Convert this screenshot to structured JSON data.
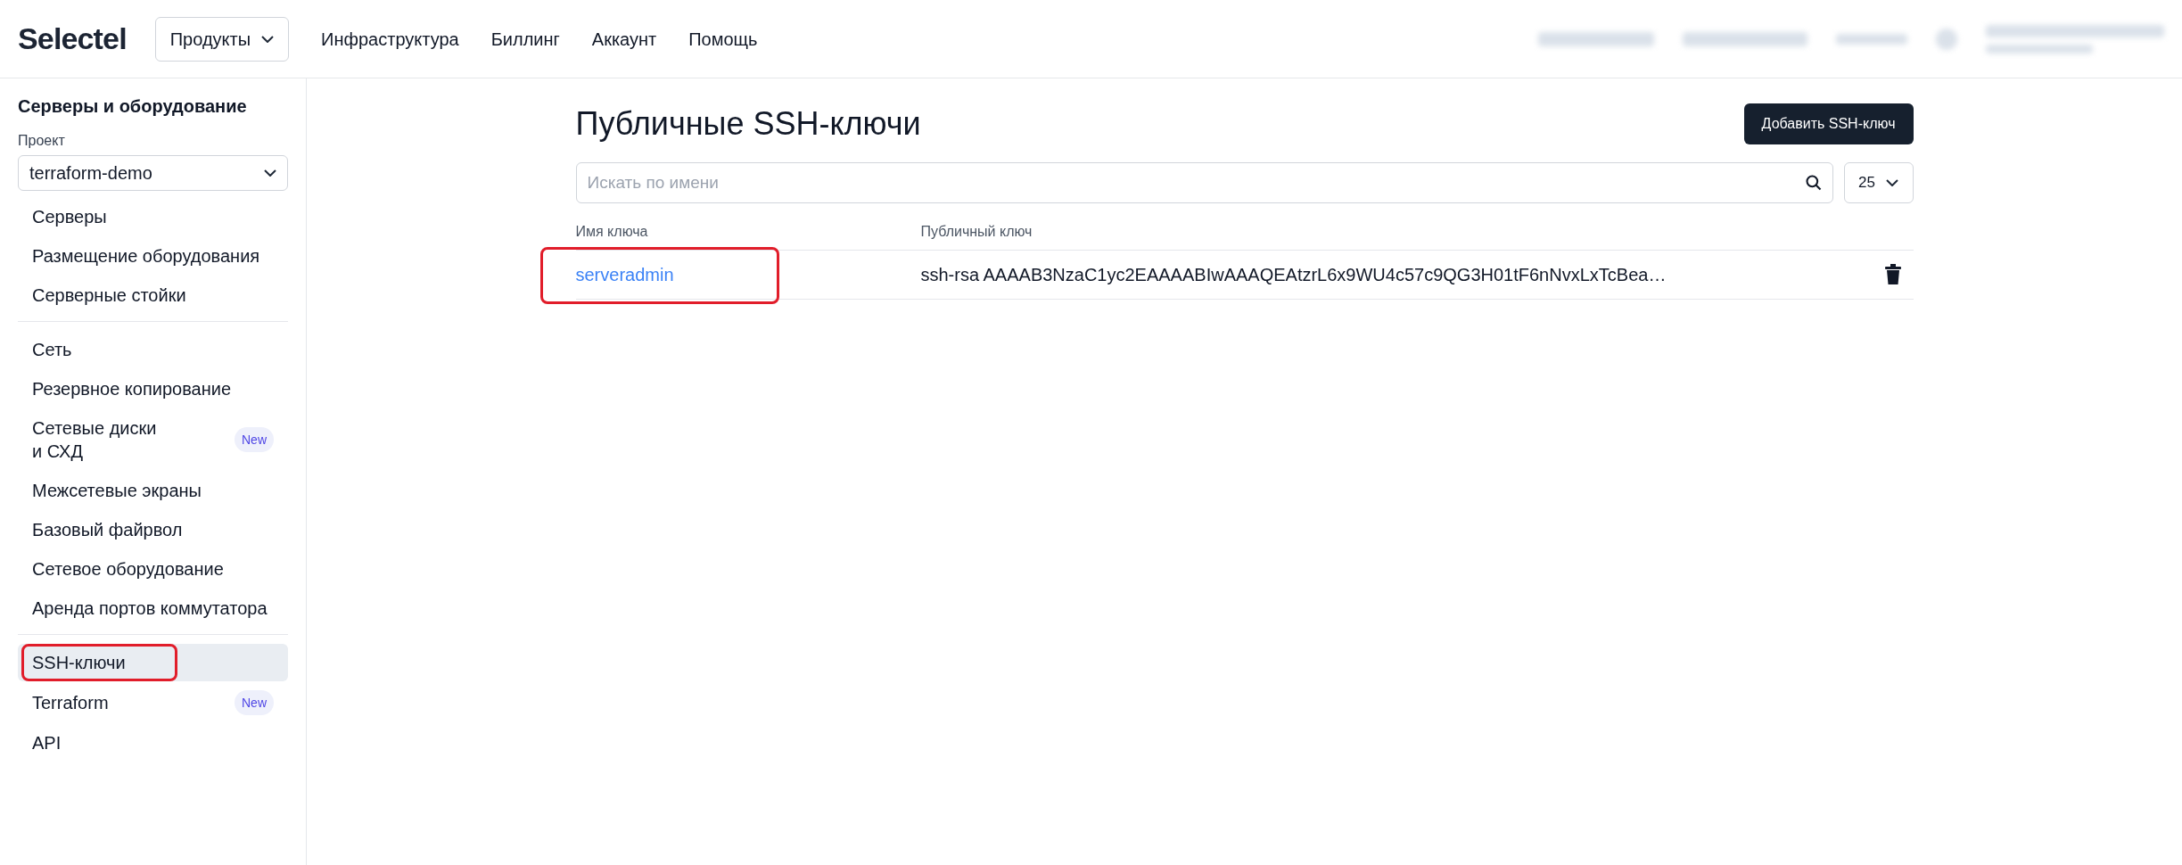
{
  "header": {
    "logo": "Selectel",
    "products": "Продукты",
    "nav": [
      "Инфраструктура",
      "Биллинг",
      "Аккаунт",
      "Помощь"
    ]
  },
  "sidebar": {
    "title": "Серверы и оборудование",
    "project_label": "Проект",
    "project": "terraform-demo",
    "groups": [
      [
        {
          "label": "Серверы",
          "selected": false
        },
        {
          "label": "Размещение оборудования",
          "selected": false
        },
        {
          "label": "Серверные стойки",
          "selected": false
        }
      ],
      [
        {
          "label": "Сеть",
          "selected": false
        },
        {
          "label": "Резервное копирование",
          "selected": false
        },
        {
          "label": "Сетевые диски\nи СХД",
          "selected": false,
          "badge": "New"
        },
        {
          "label": "Межсетевые экраны",
          "selected": false
        },
        {
          "label": "Базовый файрвол",
          "selected": false
        },
        {
          "label": "Сетевое оборудование",
          "selected": false
        },
        {
          "label": "Аренда портов коммутатора",
          "selected": false
        }
      ],
      [
        {
          "label": "SSH-ключи",
          "selected": true,
          "highlighted": true
        },
        {
          "label": "Terraform",
          "selected": false,
          "badge": "New"
        },
        {
          "label": "API",
          "selected": false
        }
      ]
    ]
  },
  "main": {
    "title": "Публичные SSH-ключи",
    "add_button": "Добавить SSH-ключ",
    "search": {
      "placeholder": "Искать по имени"
    },
    "page_size": "25",
    "table": {
      "columns": [
        "Имя ключа",
        "Публичный ключ"
      ],
      "rows": [
        {
          "name": "serveradmin",
          "key": "ssh-rsa AAAAB3NzaC1yc2EAAAABIwAAAQEAtzrL6x9WU4c57c9QG3H01tF6nNvxLxTcBea…",
          "highlighted": true
        }
      ]
    }
  }
}
